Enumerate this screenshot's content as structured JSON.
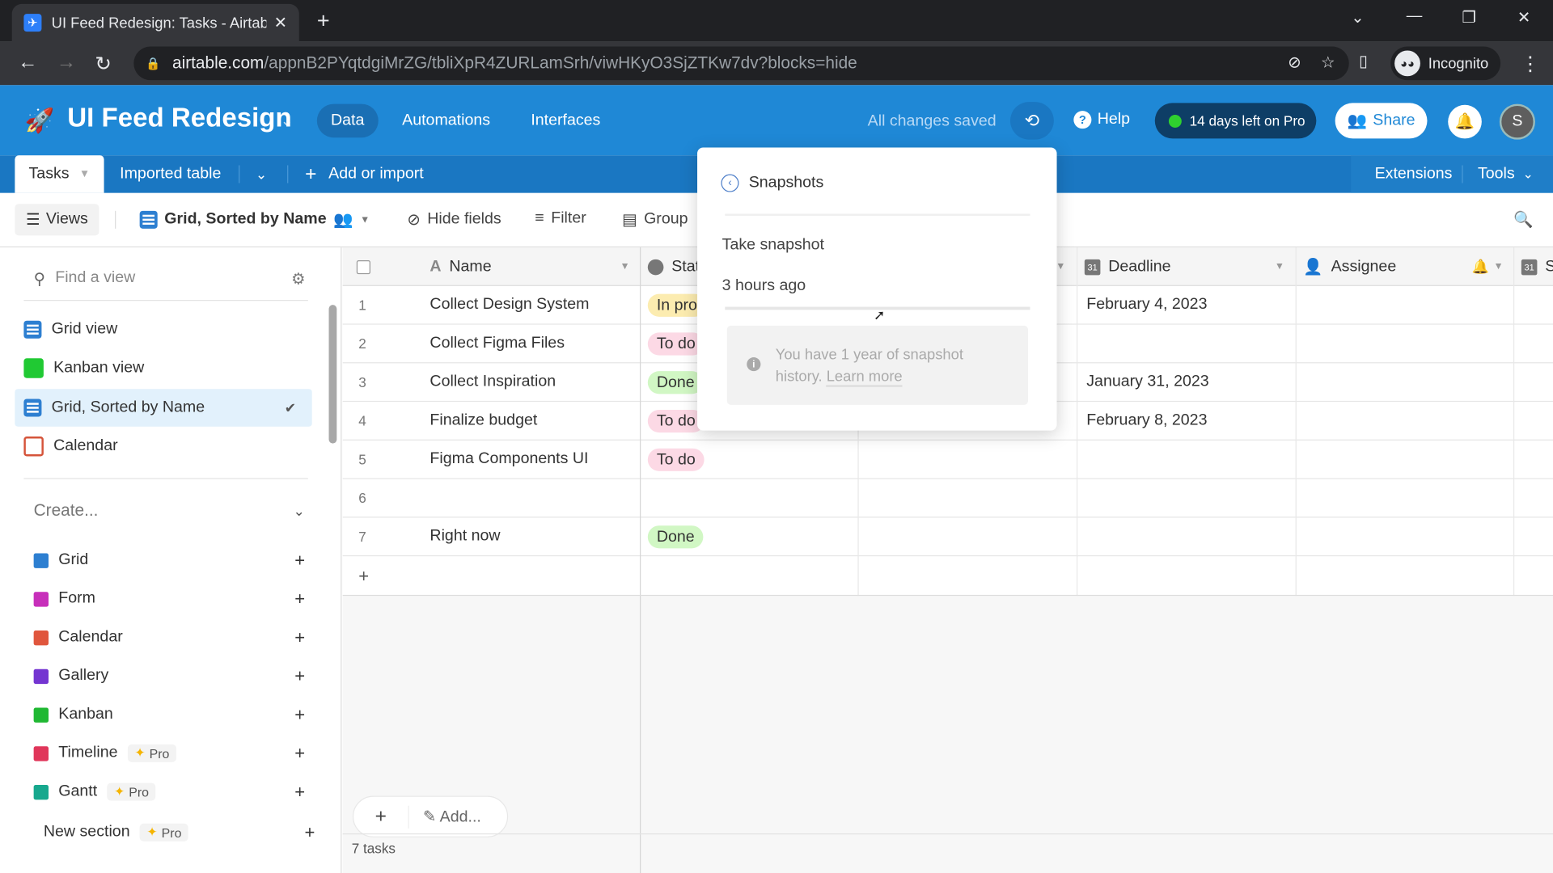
{
  "browser": {
    "tab_title": "UI Feed Redesign: Tasks - Airtable",
    "url_host": "airtable.com",
    "url_path": "/appnB2PYqtdgiMrZG/tbliXpR4ZURLamSrh/viwHKyO3SjZTKw7dv?blocks=hide",
    "profile_label": "Incognito"
  },
  "header": {
    "base_name": "UI Feed Redesign",
    "nav": [
      "Data",
      "Automations",
      "Interfaces"
    ],
    "active_nav": "Data",
    "save_status": "All changes saved",
    "help_label": "Help",
    "trial_label": "14 days left on Pro",
    "share_label": "Share",
    "avatar_initial": "S",
    "brand_color": "#1f88d6"
  },
  "tablebar": {
    "tables": [
      "Tasks",
      "Imported table"
    ],
    "add_label": "Add or import",
    "extensions_label": "Extensions",
    "tools_label": "Tools"
  },
  "viewbar": {
    "views_label": "Views",
    "current_view": "Grid, Sorted by Name",
    "hide_fields": "Hide fields",
    "filter": "Filter",
    "group": "Group"
  },
  "sidebar": {
    "search_placeholder": "Find a view",
    "views": [
      {
        "label": "Grid view",
        "icon": "grid-icon"
      },
      {
        "label": "Kanban view",
        "icon": "kanban-icon"
      },
      {
        "label": "Grid, Sorted by Name",
        "icon": "grid-icon",
        "selected": true
      },
      {
        "label": "Calendar",
        "icon": "calendar-icon"
      }
    ],
    "create_label": "Create...",
    "create_items": [
      {
        "label": "Grid"
      },
      {
        "label": "Form"
      },
      {
        "label": "Calendar"
      },
      {
        "label": "Gallery"
      },
      {
        "label": "Kanban"
      },
      {
        "label": "Timeline",
        "badge": "Pro"
      },
      {
        "label": "Gantt",
        "badge": "Pro"
      },
      {
        "label": "New section",
        "badge": "Pro"
      }
    ]
  },
  "grid": {
    "columns": [
      "Name",
      "Stat",
      "Deadline",
      "Assignee",
      "S"
    ],
    "rows": [
      {
        "num": "1",
        "name": "Collect Design System",
        "status": "In pro",
        "status_color": "#fcecb0",
        "deadline": "February 4, 2023"
      },
      {
        "num": "2",
        "name": "Collect Figma Files",
        "status": "To do",
        "status_color": "#fcd9e5",
        "deadline": ""
      },
      {
        "num": "3",
        "name": "Collect Inspiration",
        "status": "Done",
        "status_color": "#d1f7c4",
        "deadline": "January 31, 2023"
      },
      {
        "num": "4",
        "name": "Finalize budget",
        "status": "To do",
        "status_color": "#fcd9e5",
        "deadline": "February 8, 2023"
      },
      {
        "num": "5",
        "name": "Figma Components UI",
        "status": "To do",
        "status_color": "#fcd9e5",
        "deadline": ""
      },
      {
        "num": "6",
        "name": "",
        "status": "",
        "status_color": "",
        "deadline": ""
      },
      {
        "num": "7",
        "name": "Right now",
        "status": "Done",
        "status_color": "#d1f7c4",
        "deadline": ""
      }
    ],
    "add_label": "Add...",
    "record_count": "7 tasks"
  },
  "snapshots": {
    "title": "Snapshots",
    "take_label": "Take snapshot",
    "snapshot_item": "3 hours ago",
    "info_text": "You have 1 year of snapshot history.",
    "learn_more": "Learn more"
  }
}
